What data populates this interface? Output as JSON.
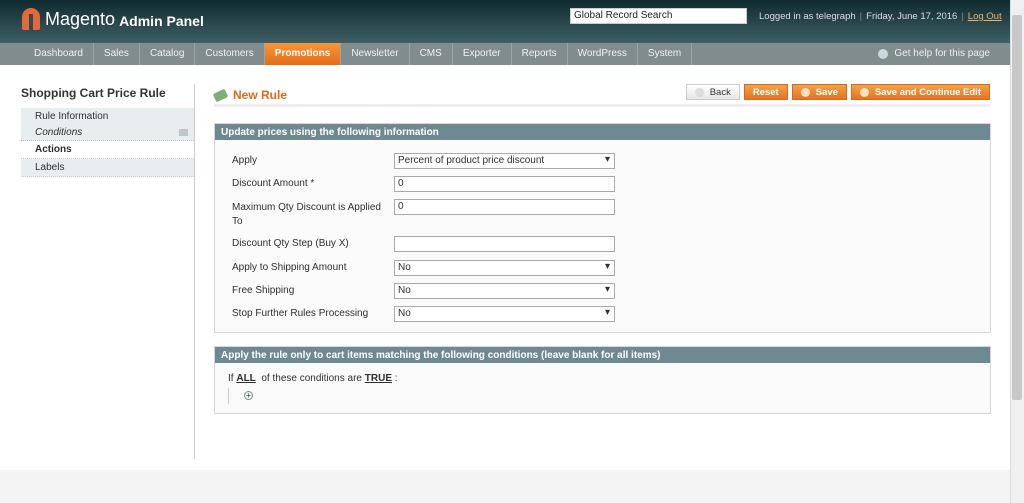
{
  "header": {
    "logo": "Magento",
    "logo_sub": "Admin Panel",
    "search_value": "Global Record Search",
    "logged_in": "Logged in as telegraph",
    "date": "Friday, June 17, 2016",
    "logout": "Log Out"
  },
  "nav": {
    "items": [
      "Dashboard",
      "Sales",
      "Catalog",
      "Customers",
      "Promotions",
      "Newsletter",
      "CMS",
      "Exporter",
      "Reports",
      "WordPress",
      "System"
    ],
    "active": "Promotions",
    "help": "Get help for this page"
  },
  "sidebar": {
    "title": "Shopping Cart Price Rule",
    "items": [
      "Rule Information",
      "Conditions",
      "Actions",
      "Labels"
    ],
    "active": "Actions"
  },
  "page": {
    "title": "New Rule",
    "buttons": {
      "back": "Back",
      "reset": "Reset",
      "save": "Save",
      "save_continue": "Save and Continue Edit"
    }
  },
  "actions": {
    "heading": "Update prices using the following information",
    "fields": [
      {
        "label": "Apply",
        "value": "Percent of product price discount",
        "type": "select"
      },
      {
        "label": "Discount Amount *",
        "value": "0",
        "type": "text"
      },
      {
        "label": "Maximum Qty Discount is Applied To",
        "value": "0",
        "type": "text"
      },
      {
        "label": "Discount Qty Step (Buy X)",
        "value": "",
        "type": "text"
      },
      {
        "label": "Apply to Shipping Amount",
        "value": "No",
        "type": "select"
      },
      {
        "label": "Free Shipping",
        "value": "No",
        "type": "select"
      },
      {
        "label": "Stop Further Rules Processing",
        "value": "No",
        "type": "select"
      }
    ]
  },
  "conditions": {
    "heading": "Apply the rule only to cart items matching the following conditions (leave blank for all items)",
    "if": "If",
    "all": "ALL",
    "middle": "of these conditions are",
    "true": "TRUE",
    "colon": ":"
  }
}
